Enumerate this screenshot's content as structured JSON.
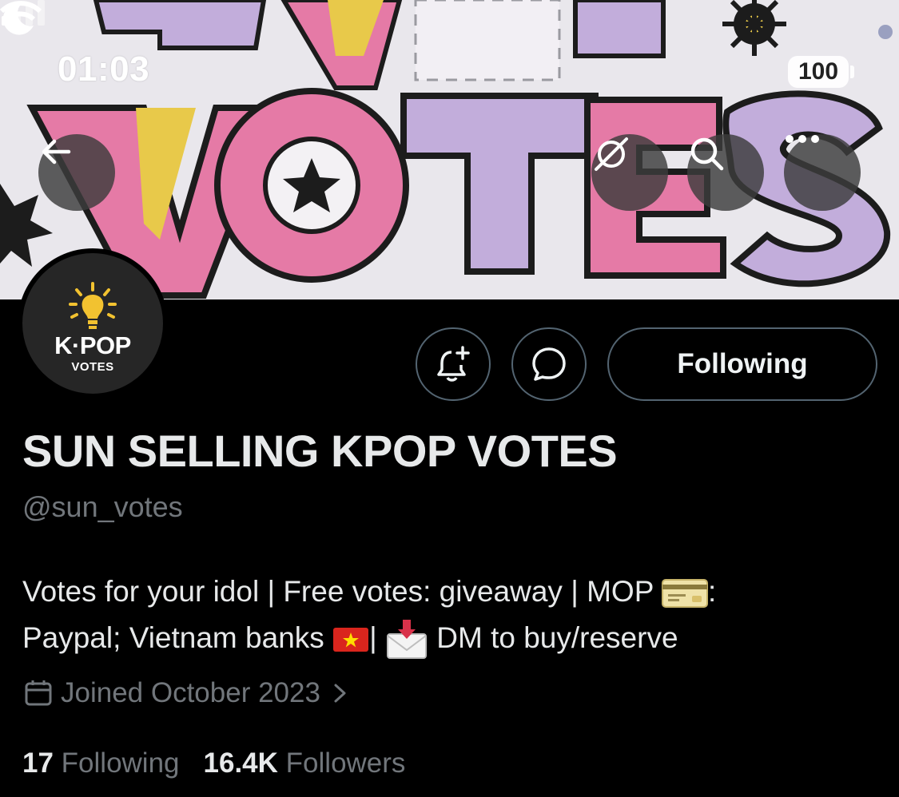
{
  "status_bar": {
    "time": "01:03",
    "battery": "100"
  },
  "header": {
    "back_icon": "arrow-left-icon",
    "grok_icon": "grok-icon",
    "search_icon": "search-icon",
    "more_icon": "more-horizontal-icon"
  },
  "banner": {
    "text": "VOTES"
  },
  "avatar": {
    "brand": "K·POP",
    "sub": "VOTES"
  },
  "actions": {
    "notify_icon": "bell-plus-icon",
    "message_icon": "message-bubble-icon",
    "following_label": "Following"
  },
  "profile": {
    "display_name": "SUN SELLING KPOP VOTES",
    "handle": "@sun_votes",
    "bio_line1_a": "Votes for your idol | Free votes: giveaway | MOP ",
    "bio_line1_b": ":",
    "bio_line2_a": "Paypal; Vietnam banks ",
    "bio_line2_b": "| ",
    "bio_line2_c": " DM to buy/reserve",
    "joined": "Joined October 2023",
    "following_count": "17",
    "following_label": "Following",
    "followers_count": "16.4K",
    "followers_label": "Followers"
  },
  "colors": {
    "background": "#000000",
    "text": "#e7e9ea",
    "muted": "#71767b",
    "border": "#536471",
    "banner_pink": "#e57aa6",
    "banner_lilac": "#c2addb",
    "banner_yellow": "#e8c94a"
  }
}
